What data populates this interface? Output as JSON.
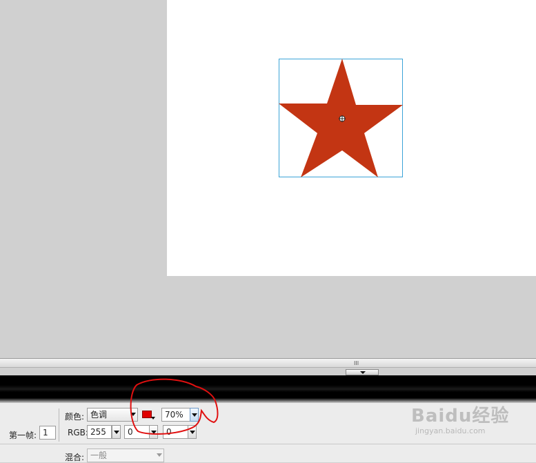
{
  "canvas": {
    "shape": "star",
    "shape_color": "#c33513",
    "selection_color": "#3aa3d8"
  },
  "divider": {
    "grip": "III"
  },
  "properties": {
    "frame_label": "第一帧:",
    "frame_value": "1",
    "color_label": "颜色:",
    "color_mode": "色调",
    "tint_color": "#e00000",
    "tint_percent": "70%",
    "rgb_label": "RGB:",
    "rgb_r": "255",
    "rgb_g": "0",
    "rgb_b": "0",
    "blend_label": "混合:",
    "blend_value": "一般"
  },
  "annotation": {
    "color": "#e01010"
  },
  "watermark": {
    "logo": "Baidu经验",
    "url": "jingyan.baidu.com"
  }
}
